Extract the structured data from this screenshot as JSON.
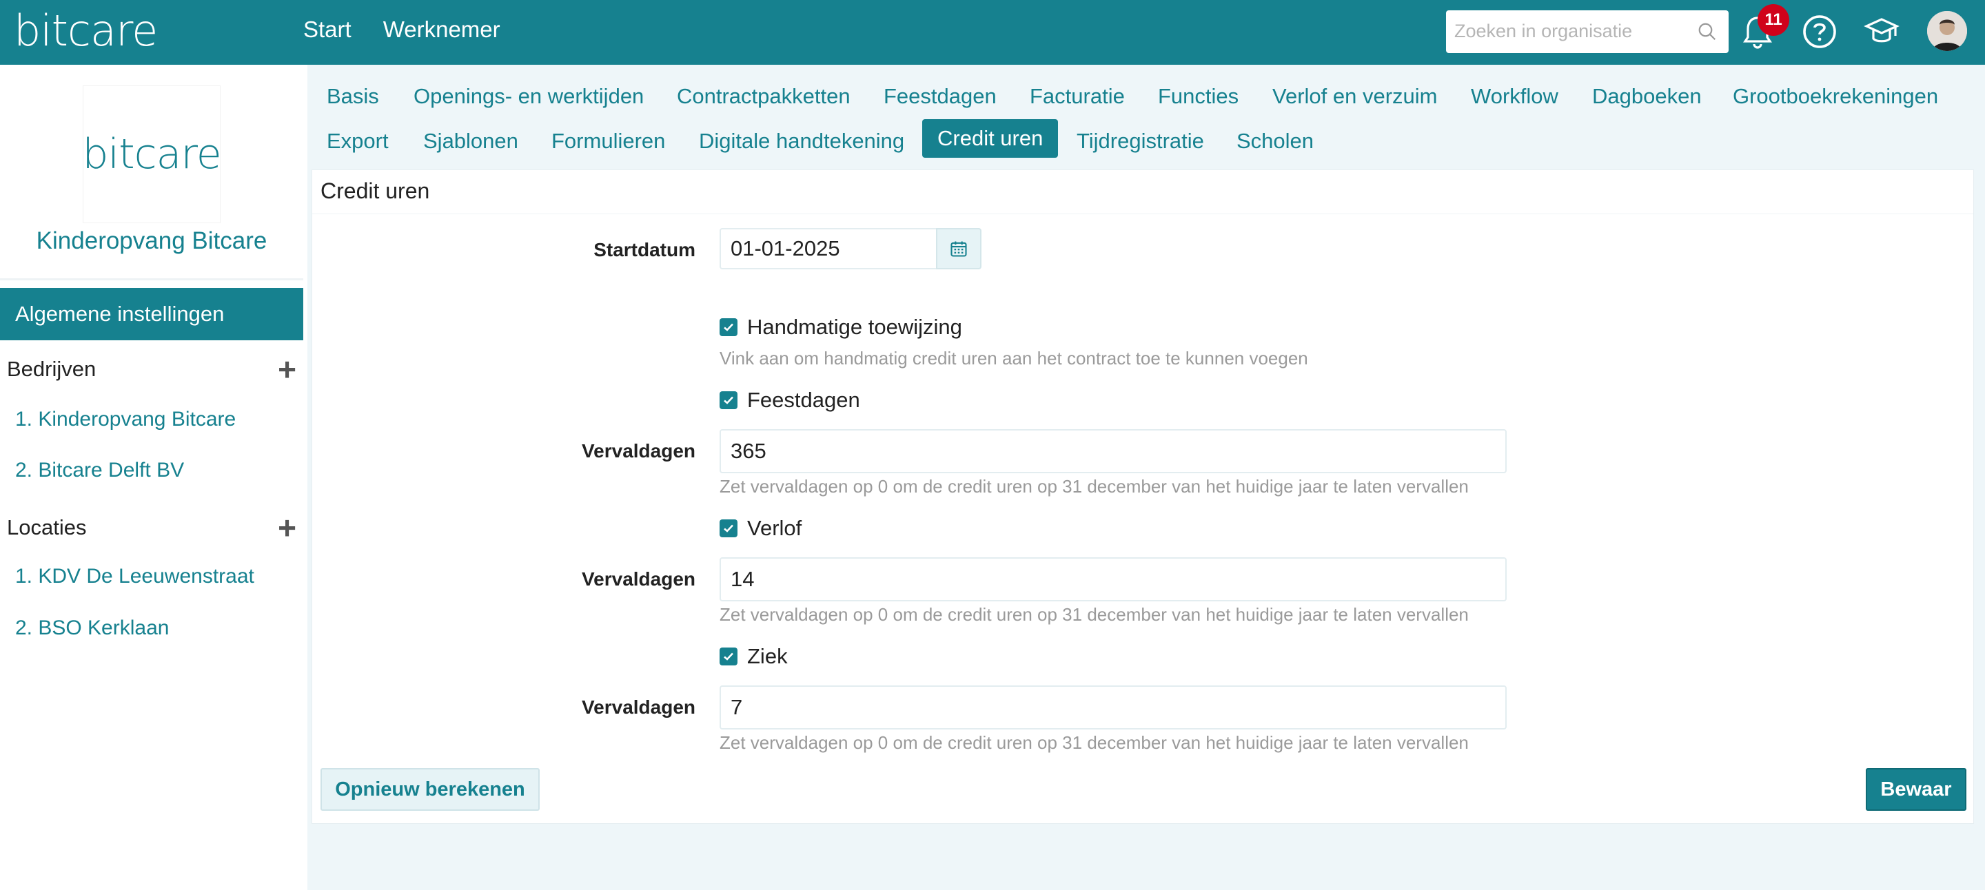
{
  "header": {
    "logo": "bitcare",
    "nav": [
      "Start",
      "Werknemer"
    ],
    "search_placeholder": "Zoeken in organisatie",
    "notification_count": "11",
    "icons": [
      "search-icon",
      "bell-icon",
      "help-icon",
      "graduation-cap-icon"
    ]
  },
  "sidebar": {
    "org_logo": "bitcare",
    "org_name": "Kinderopvang Bitcare",
    "active_item": "Algemene instellingen",
    "companies_title": "Bedrijven",
    "companies": [
      "1. Kinderopvang Bitcare",
      "2. Bitcare Delft BV"
    ],
    "locations_title": "Locaties",
    "locations": [
      "1. KDV De Leeuwenstraat",
      "2. BSO Kerklaan"
    ]
  },
  "tabs": {
    "row1": [
      "Basis",
      "Openings- en werktijden",
      "Contractpakketten",
      "Feestdagen",
      "Facturatie",
      "Functies",
      "Verlof en verzuim",
      "Workflow",
      "Dagboeken",
      "Grootboekrekeningen"
    ],
    "row2": [
      "Export",
      "Sjablonen",
      "Formulieren",
      "Digitale handtekening",
      "Credit uren",
      "Tijdregistratie",
      "Scholen"
    ],
    "active": "Credit uren"
  },
  "form": {
    "title": "Credit uren",
    "startdatum_label": "Startdatum",
    "startdatum_value": "01-01-2025",
    "manual_label": "Handmatige toewijzing",
    "manual_help": "Vink aan om handmatig credit uren aan het contract toe te kunnen voegen",
    "sections": [
      {
        "check_label": "Feestdagen",
        "field_label": "Vervaldagen",
        "value": "365",
        "help": "Zet vervaldagen op 0 om de credit uren op 31 december van het huidige jaar te laten vervallen"
      },
      {
        "check_label": "Verlof",
        "field_label": "Vervaldagen",
        "value": "14",
        "help": "Zet vervaldagen op 0 om de credit uren op 31 december van het huidige jaar te laten vervallen"
      },
      {
        "check_label": "Ziek",
        "field_label": "Vervaldagen",
        "value": "7",
        "help": "Zet vervaldagen op 0 om de credit uren op 31 december van het huidige jaar te laten vervallen"
      }
    ],
    "recalc_label": "Opnieuw berekenen",
    "save_label": "Bewaar"
  },
  "colors": {
    "primary": "#16818f",
    "badge": "#d0021b",
    "background": "#eef6f9"
  }
}
